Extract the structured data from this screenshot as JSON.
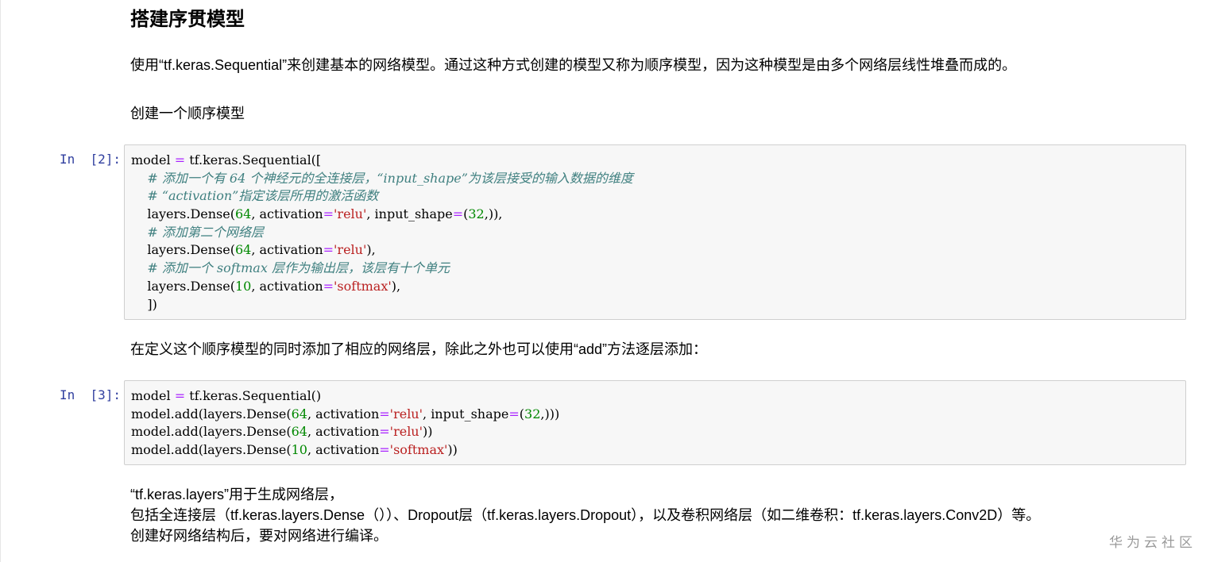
{
  "cells": {
    "heading": "搭建序贯模型",
    "intro": "使用“tf.keras.Sequential”来创建基本的网络模型。通过这种方式创建的模型又称为顺序模型，因为这种模型是由多个网络层线性堆叠而成的。",
    "create_label": "创建一个顺序模型",
    "between_text": "在定义这个顺序模型的同时添加了相应的网络层，除此之外也可以使用“add”方法逐层添加：",
    "layers_lines": [
      "“tf.keras.layers”用于生成网络层，",
      "包括全连接层（tf.keras.layers.Dense（））、Dropout层（tf.keras.layers.Dropout），以及卷积网络层（如二维卷积：tf.keras.layers.Conv2D）等。",
      "创建好网络结构后，要对网络进行编译。"
    ]
  },
  "code_cells": [
    {
      "prompt": "In  [2]:",
      "lines": [
        [
          {
            "t": "model "
          },
          {
            "t": "=",
            "k": "op"
          },
          {
            "t": " tf.keras.Sequential(["
          }
        ],
        [
          {
            "t": "    "
          },
          {
            "t": "# 添加一个有 64 个神经元的全连接层，“input_shape”为该层接受的输入数据的维度",
            "k": "com"
          }
        ],
        [
          {
            "t": "    "
          },
          {
            "t": "# “activation”指定该层所用的激活函数",
            "k": "com"
          }
        ],
        [
          {
            "t": "    layers.Dense("
          },
          {
            "t": "64",
            "k": "num"
          },
          {
            "t": ", activation"
          },
          {
            "t": "=",
            "k": "op"
          },
          {
            "t": "'relu'",
            "k": "str"
          },
          {
            "t": ", input_shape"
          },
          {
            "t": "=",
            "k": "op"
          },
          {
            "t": "("
          },
          {
            "t": "32",
            "k": "num"
          },
          {
            "t": ",)),"
          }
        ],
        [
          {
            "t": "    "
          },
          {
            "t": "# 添加第二个网络层",
            "k": "com"
          }
        ],
        [
          {
            "t": "    layers.Dense("
          },
          {
            "t": "64",
            "k": "num"
          },
          {
            "t": ", activation"
          },
          {
            "t": "=",
            "k": "op"
          },
          {
            "t": "'relu'",
            "k": "str"
          },
          {
            "t": "),"
          }
        ],
        [
          {
            "t": "    "
          },
          {
            "t": "# 添加一个 softmax 层作为输出层，该层有十个单元",
            "k": "com"
          }
        ],
        [
          {
            "t": "    layers.Dense("
          },
          {
            "t": "10",
            "k": "num"
          },
          {
            "t": ", activation"
          },
          {
            "t": "=",
            "k": "op"
          },
          {
            "t": "'softmax'",
            "k": "str"
          },
          {
            "t": "),"
          }
        ],
        [
          {
            "t": "    ])"
          }
        ]
      ]
    },
    {
      "prompt": "In  [3]:",
      "lines": [
        [
          {
            "t": "model "
          },
          {
            "t": "=",
            "k": "op"
          },
          {
            "t": " tf.keras.Sequential()"
          }
        ],
        [
          {
            "t": "model.add(layers.Dense("
          },
          {
            "t": "64",
            "k": "num"
          },
          {
            "t": ", activation"
          },
          {
            "t": "=",
            "k": "op"
          },
          {
            "t": "'relu'",
            "k": "str"
          },
          {
            "t": ", input_shape"
          },
          {
            "t": "=",
            "k": "op"
          },
          {
            "t": "("
          },
          {
            "t": "32",
            "k": "num"
          },
          {
            "t": ",)))"
          }
        ],
        [
          {
            "t": "model.add(layers.Dense("
          },
          {
            "t": "64",
            "k": "num"
          },
          {
            "t": ", activation"
          },
          {
            "t": "=",
            "k": "op"
          },
          {
            "t": "'relu'",
            "k": "str"
          },
          {
            "t": "))"
          }
        ],
        [
          {
            "t": "model.add(layers.Dense("
          },
          {
            "t": "10",
            "k": "num"
          },
          {
            "t": ", activation"
          },
          {
            "t": "=",
            "k": "op"
          },
          {
            "t": "'softmax'",
            "k": "str"
          },
          {
            "t": "))"
          }
        ]
      ]
    }
  ],
  "watermark": "华为云社区",
  "colors": {
    "prompt": "#303f9f",
    "operator": "#aa22ff",
    "number": "#008800",
    "string": "#ba2121",
    "comment": "#408080",
    "cell_background": "#f7f7f7",
    "cell_border": "#cfcfcf"
  }
}
